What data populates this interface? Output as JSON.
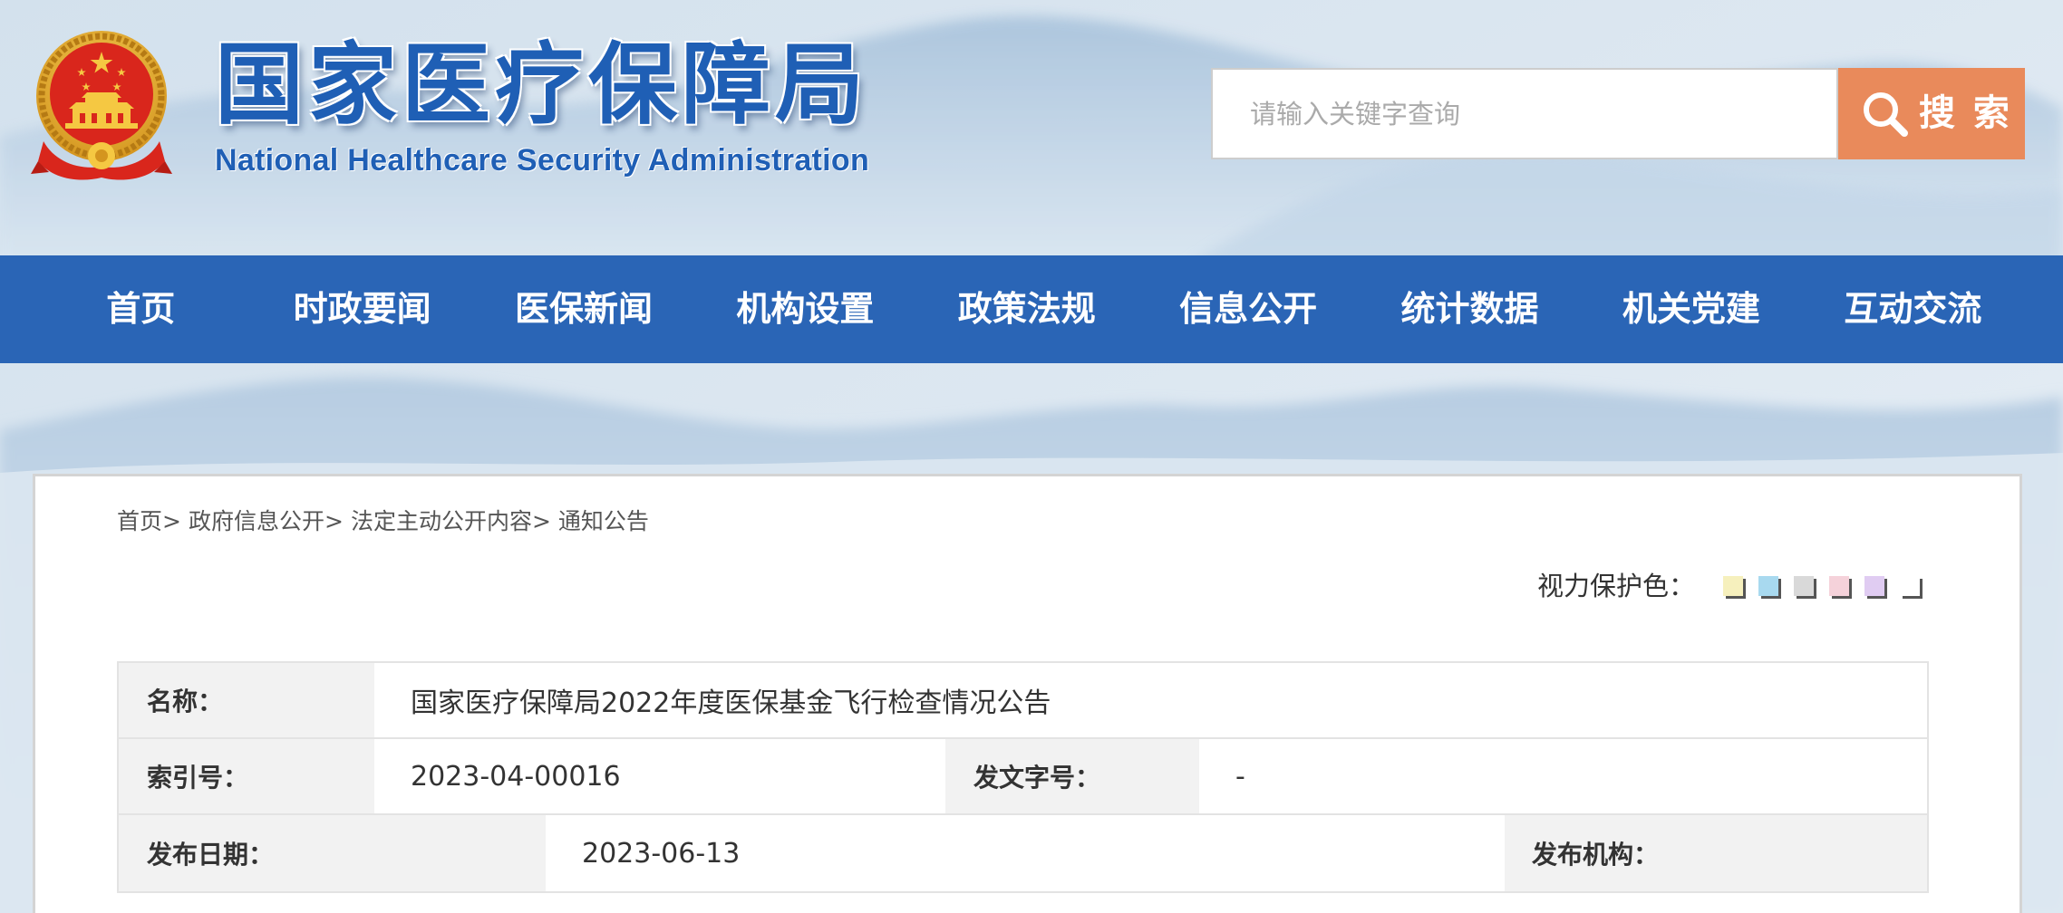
{
  "header": {
    "title": "国家医疗保障局",
    "subtitle": "National Healthcare Security Administration",
    "emblem_icon": "national-emblem-icon"
  },
  "search": {
    "placeholder": "请输入关键字查询",
    "button_label": "搜 索",
    "button_icon": "search-icon"
  },
  "nav": {
    "items": [
      "首页",
      "时政要闻",
      "医保新闻",
      "机构设置",
      "政策法规",
      "信息公开",
      "统计数据",
      "机关党建",
      "互动交流"
    ]
  },
  "breadcrumb": {
    "separator": ">",
    "items": [
      "首页",
      "政府信息公开",
      "法定主动公开内容",
      "通知公告"
    ]
  },
  "eye_care": {
    "label": "视力保护色：",
    "colors": [
      "#f6f0bd",
      "#a8d9ef",
      "#d9d9d9",
      "#f5d2da",
      "#e0ccf2",
      "#ffffff"
    ]
  },
  "info_table": {
    "name": {
      "label": "名称：",
      "value": "国家医疗保障局2022年度医保基金飞行检查情况公告"
    },
    "index_no": {
      "label": "索引号：",
      "value": "2023-04-00016"
    },
    "doc_no": {
      "label": "发文字号：",
      "value": "-"
    },
    "publish_date": {
      "label": "发布日期：",
      "value": "2023-06-13"
    },
    "publisher": {
      "label": "发布机构："
    }
  },
  "theme": {
    "nav_blue": "#2a65b6",
    "search_orange": "#e98a5b",
    "title_blue": "#1f5fb5",
    "label_cell_gray": "#f2f2f2"
  }
}
